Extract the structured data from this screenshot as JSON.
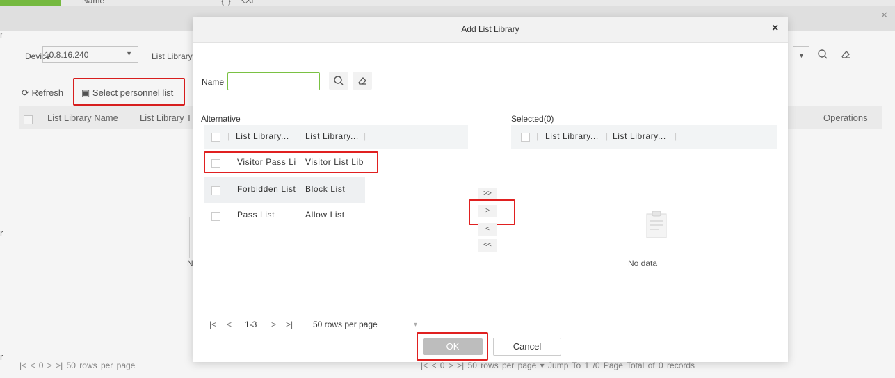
{
  "background": {
    "top_name": "Name",
    "top_icons": "{} ⌫",
    "device_label": "Device",
    "device_value": "10.8.16.240",
    "list_library_label": "List Library",
    "refresh_label": "Refresh",
    "select_personnel_label": "Select personnel list",
    "columns": [
      "List Library Name",
      "List Library T"
    ],
    "operations_label": "Operations",
    "nodata_partial": "N",
    "footer_left": "|<   <    0    >   >|     50 rows per page",
    "footer_right": "|<   <    0    >   >|      50 rows per page  ▾   Jump To   1      /0 Page    Total of 0 records",
    "side_glyphs": [
      "r",
      "r",
      "r"
    ]
  },
  "dialog": {
    "title": "Add List Library",
    "close": "×",
    "name_label": "Name",
    "name_value": "",
    "search_icon": "search-icon",
    "clear_icon": "eraser-icon",
    "alternative_label": "Alternative",
    "selected_label": "Selected(0)",
    "alt_headers": [
      "List Library...",
      "List Library..."
    ],
    "sel_headers": [
      "List Library...",
      "List Library..."
    ],
    "rows": [
      {
        "name": "Visitor Pass Li",
        "type": "Visitor List Lib"
      },
      {
        "name": "Forbidden List",
        "type": "Block List"
      },
      {
        "name": "Pass List",
        "type": "Allow List"
      }
    ],
    "move_buttons": [
      ">>",
      ">",
      "<",
      "<<"
    ],
    "no_data": "No data",
    "pager": {
      "first": "|<",
      "prev": "<",
      "range": "1-3",
      "next": ">",
      "last": ">|",
      "rows_per_page": "50 rows per page",
      "rows_caret": "▾"
    },
    "ok_label": "OK",
    "cancel_label": "Cancel"
  },
  "colors": {
    "accent_green": "#7ac143",
    "highlight_red": "#e02020",
    "ok_disabled": "#bdbdbd"
  }
}
